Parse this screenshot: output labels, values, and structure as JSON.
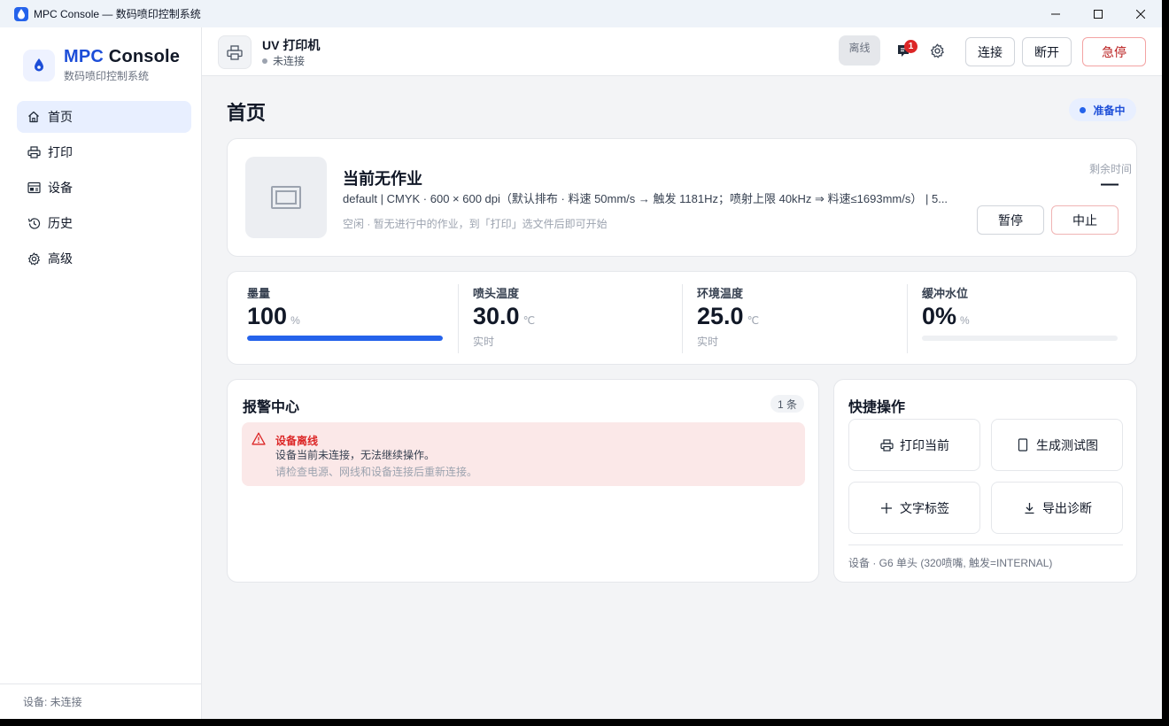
{
  "window": {
    "title": "MPC Console — 数码喷印控制系统"
  },
  "brand": {
    "name_part1": "MPC",
    "name_part2": " Console",
    "subtitle": "数码喷印控制系统"
  },
  "nav": {
    "items": [
      {
        "label": "首页",
        "icon": "home-icon",
        "active": true
      },
      {
        "label": "打印",
        "icon": "printer-icon",
        "active": false
      },
      {
        "label": "设备",
        "icon": "device-icon",
        "active": false
      },
      {
        "label": "历史",
        "icon": "history-icon",
        "active": false
      },
      {
        "label": "高级",
        "icon": "gear-icon",
        "active": false
      }
    ]
  },
  "sidebar_footer": "设备: 未连接",
  "header": {
    "device_name": "UV 打印机",
    "device_status": "未连接",
    "offline_badge": "离线",
    "notification_count": "1",
    "connect": "连接",
    "disconnect": "断开",
    "estop": "急停"
  },
  "page": {
    "title": "首页",
    "state": "准备中"
  },
  "job": {
    "title": "当前无作业",
    "params": "default | CMYK · 600 × 600 dpi（默认排布 · 料速 50mm/s → 触发 1181Hz；喷射上限 40kHz ⇒ 料速≤1693mm/s） | 5...",
    "hint": "空闲 · 暂无进行中的作业，到「打印」选文件后即可开始",
    "remaining_label": "剩余时间",
    "remaining_value": "—",
    "pause": "暂停",
    "abort": "中止"
  },
  "metrics": {
    "ink": {
      "label": "墨量",
      "value": "100",
      "unit": "%",
      "level": 100
    },
    "head_temp": {
      "label": "喷头温度",
      "value": "30.0",
      "unit": "℃",
      "sub": "实时"
    },
    "env_temp": {
      "label": "环境温度",
      "value": "25.0",
      "unit": "℃",
      "sub": "实时"
    },
    "buffer": {
      "label": "缓冲水位",
      "value": "0%",
      "unit": "%",
      "level": 0
    }
  },
  "alarms": {
    "title": "报警中心",
    "count": "1 条",
    "items": [
      {
        "title": "设备离线",
        "message": "设备当前未连接，无法继续操作。",
        "hint": "请检查电源、网线和设备连接后重新连接。"
      }
    ]
  },
  "quick": {
    "title": "快捷操作",
    "print_current": "打印当前",
    "test_pattern": "生成测试图",
    "text_label": "文字标签",
    "export_diag": "导出诊断",
    "footer": "设备 · G6 单头 (320喷嘴, 触发=INTERNAL)"
  },
  "colors": {
    "accent": "#2563eb",
    "danger": "#dc2626",
    "active_nav_bg": "#e8efff"
  }
}
